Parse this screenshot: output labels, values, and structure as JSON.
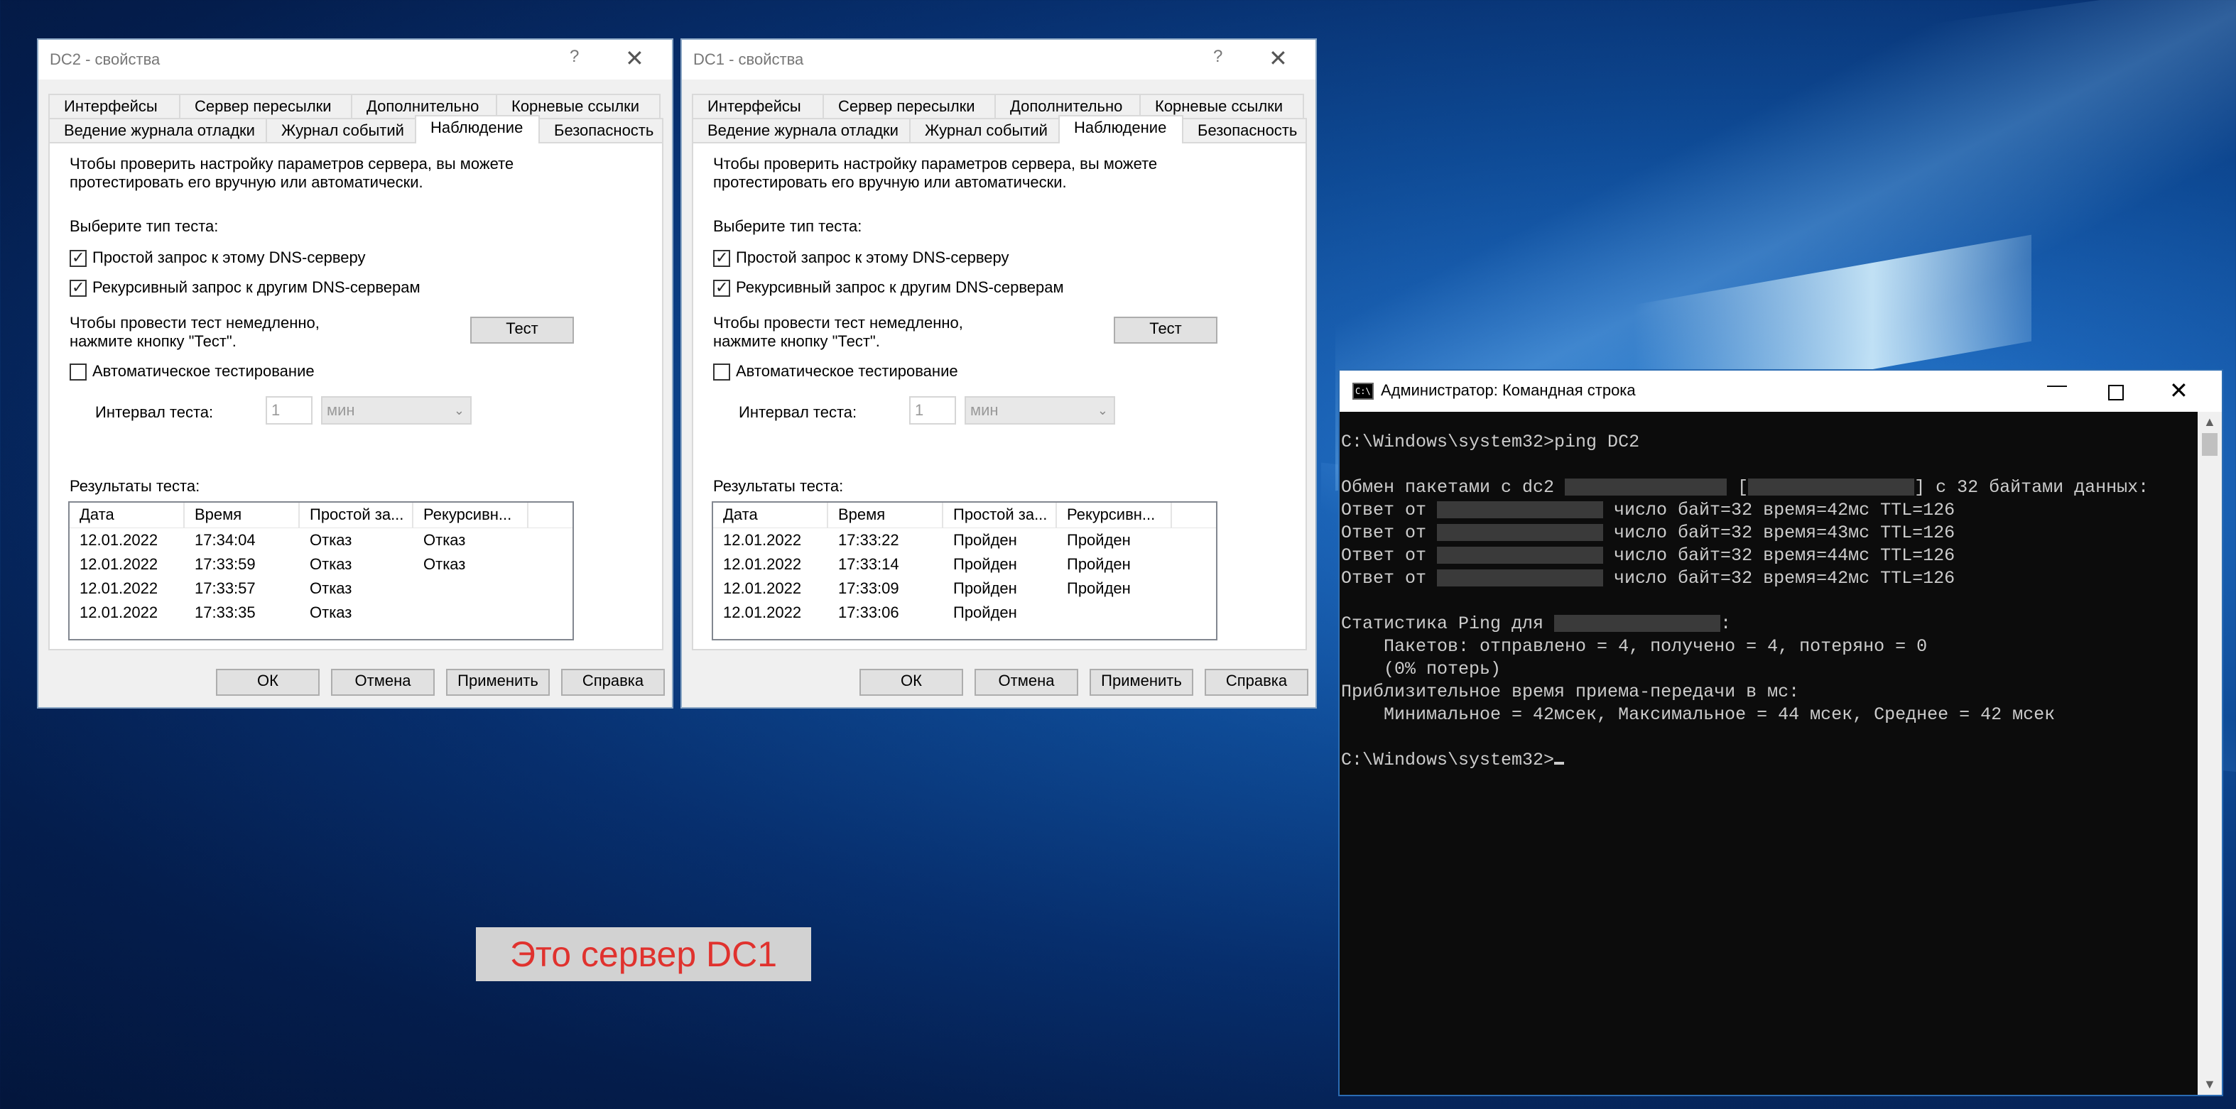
{
  "dialogs": [
    {
      "title": "DC2 - свойства",
      "help": "?",
      "close": "✕",
      "tabs_row1": [
        "Интерфейсы",
        "Сервер пересылки",
        "Дополнительно",
        "Корневые ссылки"
      ],
      "tabs_row2": [
        "Ведение журнала отладки",
        "Журнал событий",
        "Наблюдение",
        "Безопасность"
      ],
      "active_tab": "Наблюдение",
      "intro_line1": "Чтобы проверить настройку параметров сервера, вы можете",
      "intro_line2": "протестировать его вручную или автоматически.",
      "select_type": "Выберите тип теста:",
      "simple_query": "Простой запрос к этому DNS-серверу",
      "recursive_query": "Рекурсивный запрос к другим DNS-серверам",
      "test_now_line1": "Чтобы провести тест немедленно,",
      "test_now_line2": "нажмите кнопку \"Тест\".",
      "test_button": "Тест",
      "auto_test": "Автоматическое тестирование",
      "interval_label": "Интервал теста:",
      "interval_value": "1",
      "interval_unit": "мин",
      "results_label": "Результаты теста:",
      "columns": [
        "Дата",
        "Время",
        "Простой за...",
        "Рекурсивн..."
      ],
      "rows": [
        [
          "12.01.2022",
          "17:34:04",
          "Отказ",
          "Отказ"
        ],
        [
          "12.01.2022",
          "17:33:59",
          "Отказ",
          "Отказ"
        ],
        [
          "12.01.2022",
          "17:33:57",
          "Отказ",
          ""
        ],
        [
          "12.01.2022",
          "17:33:35",
          "Отказ",
          ""
        ]
      ],
      "ok": "ОК",
      "cancel": "Отмена",
      "apply": "Применить",
      "help_btn": "Справка"
    },
    {
      "title": "DC1 - свойства",
      "help": "?",
      "close": "✕",
      "tabs_row1": [
        "Интерфейсы",
        "Сервер пересылки",
        "Дополнительно",
        "Корневые ссылки"
      ],
      "tabs_row2": [
        "Ведение журнала отладки",
        "Журнал событий",
        "Наблюдение",
        "Безопасность"
      ],
      "active_tab": "Наблюдение",
      "intro_line1": "Чтобы проверить настройку параметров сервера, вы можете",
      "intro_line2": "протестировать его вручную или автоматически.",
      "select_type": "Выберите тип теста:",
      "simple_query": "Простой запрос к этому DNS-серверу",
      "recursive_query": "Рекурсивный запрос к другим DNS-серверам",
      "test_now_line1": "Чтобы провести тест немедленно,",
      "test_now_line2": "нажмите кнопку \"Тест\".",
      "test_button": "Тест",
      "auto_test": "Автоматическое тестирование",
      "interval_label": "Интервал теста:",
      "interval_value": "1",
      "interval_unit": "мин",
      "results_label": "Результаты теста:",
      "columns": [
        "Дата",
        "Время",
        "Простой за...",
        "Рекурсивн..."
      ],
      "rows": [
        [
          "12.01.2022",
          "17:33:22",
          "Пройден",
          "Пройден"
        ],
        [
          "12.01.2022",
          "17:33:14",
          "Пройден",
          "Пройден"
        ],
        [
          "12.01.2022",
          "17:33:09",
          "Пройден",
          "Пройден"
        ],
        [
          "12.01.2022",
          "17:33:06",
          "Пройден",
          ""
        ]
      ],
      "ok": "ОК",
      "cancel": "Отмена",
      "apply": "Применить",
      "help_btn": "Справка"
    }
  ],
  "cmd": {
    "title": "Администратор: Командная строка",
    "icon_text": "C:\\",
    "prompt_cmd": "C:\\Windows\\system32>ping DC2",
    "exchange_a": "Обмен пакетами с dc2 ",
    "exchange_b": " [",
    "exchange_c": "] с 32 байтами данных:",
    "reply_prefix": "Ответ от ",
    "replies": [
      " число байт=32 время=42мс TTL=126",
      " число байт=32 время=43мс TTL=126",
      " число байт=32 время=44мс TTL=126",
      " число байт=32 время=42мс TTL=126"
    ],
    "stats_prefix": "Статистика Ping для ",
    "stats_suffix": ":",
    "packets": "    Пакетов: отправлено = 4, получено = 4, потеряно = 0",
    "loss": "    (0% потерь)",
    "rtt_header": "Приблизительное время приема-передачи в мс:",
    "rtt_values": "    Минимальное = 42мсек, Максимальное = 44 мсек, Среднее = 42 мсек",
    "final_prompt": "C:\\Windows\\system32>"
  },
  "annotation": "Это сервер DC1"
}
